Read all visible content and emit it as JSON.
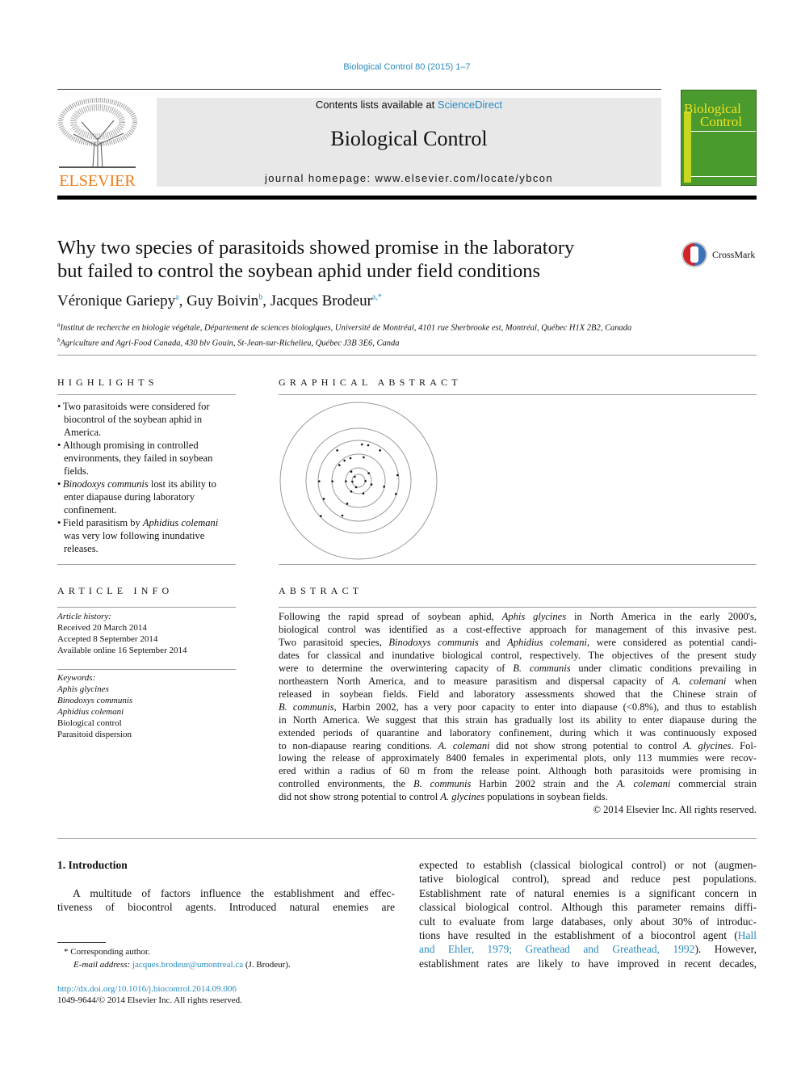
{
  "header": {
    "citation": "Biological Control 80 (2015) 1–7",
    "contents_prefix": "Contents lists available at ",
    "contents_link": "ScienceDirect",
    "journal_title": "Biological Control",
    "homepage": "journal homepage: www.elsevier.com/locate/ybcon",
    "publisher_logo": "ELSEVIER",
    "cover_title_1": "Biological",
    "cover_title_2": "Control",
    "colors": {
      "link": "#2a8bbf",
      "elsevier_orange": "#f07c16",
      "cover_green": "#4a9a2e",
      "cover_yellow": "#f2e21a"
    }
  },
  "article": {
    "title_line1": "Why two species of parasitoids showed promise in the laboratory",
    "title_line2": "but failed to control the soybean aphid under field conditions",
    "crossmark": "CrossMark",
    "authors": [
      {
        "name": "Véronique Gariepy",
        "sup": "a"
      },
      {
        "name": "Guy Boivin",
        "sup": "b"
      },
      {
        "name": "Jacques Brodeur",
        "sup": "a,*"
      }
    ],
    "affiliations": [
      {
        "sup": "a",
        "text": "Institut de recherche en biologie végétale, Département de sciences biologiques, Université de Montréal, 4101 rue Sherbrooke est, Montréal, Québec H1X 2B2, Canada"
      },
      {
        "sup": "b",
        "text": "Agriculture and Agri-Food Canada, 430 blv Gouin, St-Jean-sur-Richelieu, Québec J3B 3E6, Canda"
      }
    ]
  },
  "highlights": {
    "heading": "HIGHLIGHTS",
    "lines": [
      [
        {
          "t": "• Two parasitoids were considered for"
        }
      ],
      [
        {
          "t": "biocontrol of the soybean aphid in"
        }
      ],
      [
        {
          "t": "America."
        }
      ],
      [
        {
          "t": "• Although promising in controlled"
        }
      ],
      [
        {
          "t": "environments, they failed in soybean"
        }
      ],
      [
        {
          "t": "fields."
        }
      ],
      [
        {
          "t": "• "
        },
        {
          "t": "Binodoxys communis",
          "i": true
        },
        {
          "t": " lost its ability to"
        }
      ],
      [
        {
          "t": "enter diapause during laboratory"
        }
      ],
      [
        {
          "t": "confinement."
        }
      ],
      [
        {
          "t": "• Field parasitism by "
        },
        {
          "t": "Aphidius colemani",
          "i": true
        }
      ],
      [
        {
          "t": "was very low following inundative"
        }
      ],
      [
        {
          "t": "releases."
        }
      ]
    ]
  },
  "graphical_abstract": {
    "heading": "GRAPHICAL ABSTRACT"
  },
  "article_info": {
    "heading": "ARTICLE INFO",
    "history_label": "Article history:",
    "history": [
      "Received 20 March 2014",
      "Accepted 8 September 2014",
      "Available online 16 September 2014"
    ],
    "keywords_label": "Keywords:",
    "keywords": [
      {
        "t": "Aphis glycines",
        "i": true
      },
      {
        "t": "Binodoxys communis",
        "i": true
      },
      {
        "t": "Aphidius colemani",
        "i": true
      },
      {
        "t": "Biological control"
      },
      {
        "t": "Parasitoid dispersion"
      }
    ]
  },
  "abstract": {
    "heading": "ABSTRACT",
    "lines": [
      [
        {
          "t": "Following the rapid spread of soybean aphid, "
        },
        {
          "t": "Aphis glycines",
          "i": true
        },
        {
          "t": " in North America in the early 2000's,"
        }
      ],
      [
        {
          "t": "biological control was identified as a cost-effective approach for management of this invasive pest."
        }
      ],
      [
        {
          "t": "Two parasitoid species, "
        },
        {
          "t": "Binodoxys communis",
          "i": true
        },
        {
          "t": " and "
        },
        {
          "t": "Aphidius colemani",
          "i": true
        },
        {
          "t": ", were considered as potential candi-"
        }
      ],
      [
        {
          "t": "dates for classical and inundative biological control, respectively. The objectives of the present study"
        }
      ],
      [
        {
          "t": "were to determine the overwintering capacity of "
        },
        {
          "t": "B. communis",
          "i": true
        },
        {
          "t": " under climatic conditions prevailing in"
        }
      ],
      [
        {
          "t": "northeastern North America, and to measure parasitism and dispersal capacity of "
        },
        {
          "t": "A. colemani",
          "i": true
        },
        {
          "t": " when"
        }
      ],
      [
        {
          "t": "released in soybean fields. Field and laboratory assessments showed that the Chinese strain of"
        }
      ],
      [
        {
          "t": "B. communis",
          "i": true
        },
        {
          "t": ", Harbin 2002, has a very poor capacity to enter into diapause (<0.8%), and thus to establish"
        }
      ],
      [
        {
          "t": "in North America. We suggest that this strain has gradually lost its ability to enter diapause during the"
        }
      ],
      [
        {
          "t": "extended periods of quarantine and laboratory confinement, during which it was continuously exposed"
        }
      ],
      [
        {
          "t": "to non-diapause rearing conditions. "
        },
        {
          "t": "A. colemani",
          "i": true
        },
        {
          "t": " did not show strong potential to control "
        },
        {
          "t": "A. glycines",
          "i": true
        },
        {
          "t": ". Fol-"
        }
      ],
      [
        {
          "t": "lowing the release of approximately 8400 females in experimental plots, only 113 mummies were recov-"
        }
      ],
      [
        {
          "t": "ered within a radius of 60 m from the release point. Although both parasitoids were promising in"
        }
      ],
      [
        {
          "t": "controlled environments, the "
        },
        {
          "t": "B. communis",
          "i": true
        },
        {
          "t": " Harbin 2002 strain and the "
        },
        {
          "t": "A. colemani",
          "i": true
        },
        {
          "t": " commercial strain"
        }
      ],
      [
        {
          "t": "did not show strong potential to control "
        },
        {
          "t": "A. glycines",
          "i": true
        },
        {
          "t": " populations in soybean fields."
        }
      ]
    ],
    "copyright": "© 2014 Elsevier Inc. All rights reserved."
  },
  "introduction": {
    "heading": "1. Introduction",
    "left_lines": [
      [
        {
          "t": "A multitude of factors influence the establishment and effec-"
        }
      ],
      [
        {
          "t": "tiveness of biocontrol agents. Introduced natural enemies are"
        }
      ]
    ],
    "right_lines": [
      [
        {
          "t": "expected to establish (classical biological control) or not (augmen-"
        }
      ],
      [
        {
          "t": "tative biological control), spread and reduce pest populations."
        }
      ],
      [
        {
          "t": "Establishment rate of natural enemies is a significant concern in"
        }
      ],
      [
        {
          "t": "classical biological control. Although this parameter remains diffi-"
        }
      ],
      [
        {
          "t": "cult to evaluate from large databases, only about 30% of introduc-"
        }
      ],
      [
        {
          "t": "tions have resulted in the establishment of a biocontrol agent ("
        },
        {
          "t": "Hall",
          "l": true
        }
      ],
      [
        {
          "t": "and Ehler, 1979; Greathead and Greathead, 1992",
          "l": true
        },
        {
          "t": "). However,"
        }
      ],
      [
        {
          "t": "establishment rates are likely to have improved in recent decades,"
        }
      ]
    ]
  },
  "footnote": {
    "corresponding": "Corresponding author.",
    "email_label": "E-mail address: ",
    "email": "jacques.brodeur@umontreal.ca",
    "email_suffix": " (J. Brodeur).",
    "doi": "http://dx.doi.org/10.1016/j.biocontrol.2014.09.006",
    "issn": "1049-9644/© 2014 Elsevier Inc. All rights reserved."
  }
}
